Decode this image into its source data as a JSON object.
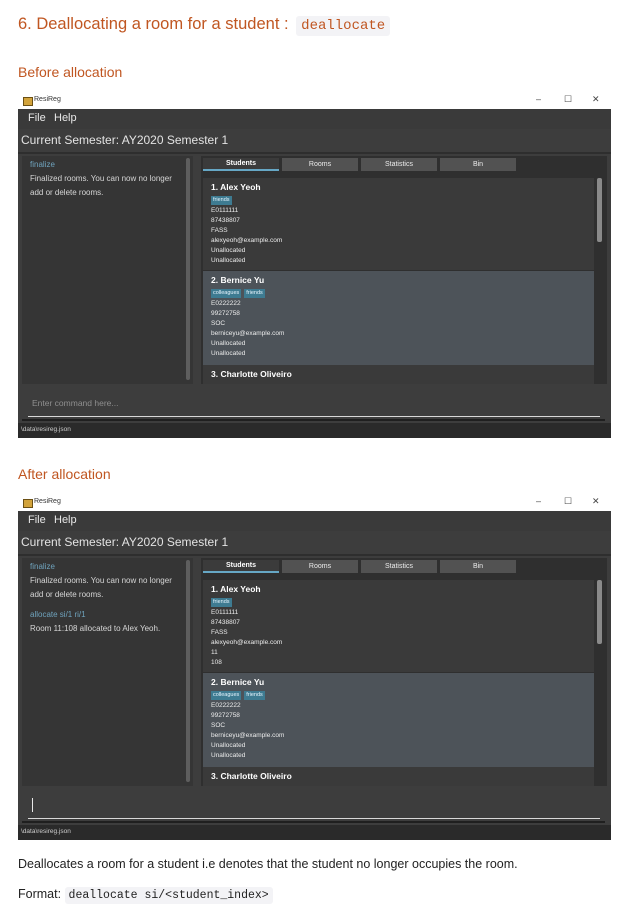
{
  "heading": {
    "text": "6. Deallocating a room for a student :",
    "code": "deallocate"
  },
  "before_label": "Before allocation",
  "after_label": "After allocation",
  "description": "Deallocates a room for a student i.e denotes that the student no longer occupies the room.",
  "format": {
    "label": "Format:",
    "code": "deallocate si/<student_index>"
  },
  "app": {
    "title": "ResiReg",
    "menu": {
      "file": "File",
      "help": "Help"
    },
    "window_controls": {
      "minimize": "–",
      "maximize": "☐",
      "close": "✕"
    },
    "semester": "Current Semester: AY2020 Semester 1",
    "tabs": {
      "students": "Students",
      "rooms": "Rooms",
      "statistics": "Statistics",
      "bin": "Bin"
    },
    "status_path": "\\data\\resireg.json",
    "command_placeholder": "Enter command here..."
  },
  "before": {
    "results": {
      "cmd1": "finalize",
      "msg1": "Finalized rooms. You can now no longer add or delete rooms."
    },
    "students": [
      {
        "name": "1.  Alex Yeoh",
        "tag1": "friends",
        "id": "E0111111",
        "phone": "87438807",
        "faculty": "FASS",
        "email": "alexyeoh@example.com",
        "line6": "Unallocated",
        "line7": "Unallocated"
      },
      {
        "name": "2.  Bernice Yu",
        "tag1": "colleagues",
        "tag2": "friends",
        "id": "E0222222",
        "phone": "99272758",
        "faculty": "SOC",
        "email": "berniceyu@example.com",
        "line6": "Unallocated",
        "line7": "Unallocated"
      },
      {
        "name": "3.  Charlotte Oliveiro"
      }
    ]
  },
  "after": {
    "results": {
      "cmd1": "finalize",
      "msg1": "Finalized rooms. You can now no longer add or delete rooms.",
      "cmd2": "allocate si/1 ri/1",
      "msg2": "Room 11:108 allocated to Alex Yeoh."
    },
    "students": [
      {
        "name": "1.  Alex Yeoh",
        "tag1": "friends",
        "id": "E0111111",
        "phone": "87438807",
        "faculty": "FASS",
        "email": "alexyeoh@example.com",
        "line6": "11",
        "line7": "108"
      },
      {
        "name": "2.  Bernice Yu",
        "tag1": "colleagues",
        "tag2": "friends",
        "id": "E0222222",
        "phone": "99272758",
        "faculty": "SOC",
        "email": "berniceyu@example.com",
        "line6": "Unallocated",
        "line7": "Unallocated"
      },
      {
        "name": "3.  Charlotte Oliveiro"
      }
    ]
  }
}
